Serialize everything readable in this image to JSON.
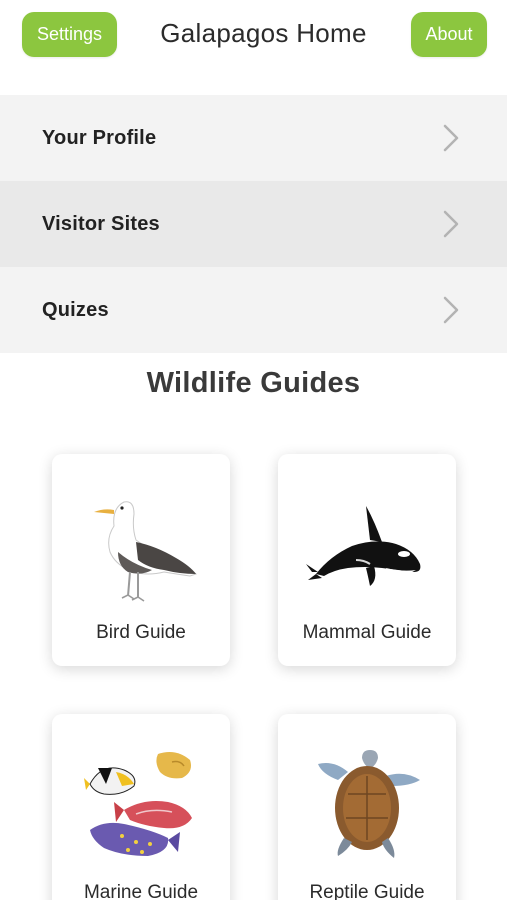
{
  "header": {
    "settings_label": "Settings",
    "title": "Galapagos Home",
    "about_label": "About",
    "accent_color": "#8cc63f"
  },
  "menu": {
    "items": [
      {
        "label": "Your Profile",
        "icon": "chevron-right-icon"
      },
      {
        "label": "Visitor Sites",
        "icon": "chevron-right-icon"
      },
      {
        "label": "Quizes",
        "icon": "chevron-right-icon"
      }
    ]
  },
  "guides": {
    "title": "Wildlife Guides",
    "cards": [
      {
        "label": "Bird Guide",
        "icon": "albatross-icon"
      },
      {
        "label": "Mammal Guide",
        "icon": "orca-icon"
      },
      {
        "label": "Marine Guide",
        "icon": "tropical-fish-icon"
      },
      {
        "label": "Reptile Guide",
        "icon": "sea-turtle-icon"
      }
    ]
  }
}
